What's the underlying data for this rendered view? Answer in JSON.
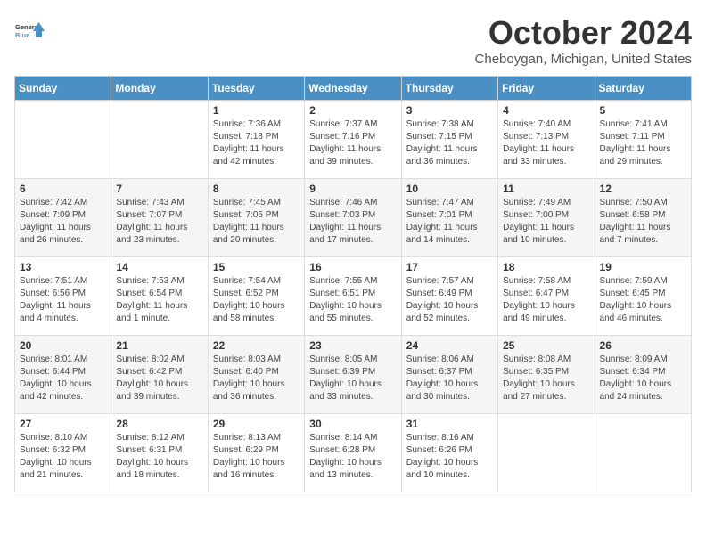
{
  "header": {
    "logo_line1": "General",
    "logo_line2": "Blue",
    "month_title": "October 2024",
    "location": "Cheboygan, Michigan, United States"
  },
  "days_of_week": [
    "Sunday",
    "Monday",
    "Tuesday",
    "Wednesday",
    "Thursday",
    "Friday",
    "Saturday"
  ],
  "weeks": [
    [
      {
        "day": "",
        "content": ""
      },
      {
        "day": "",
        "content": ""
      },
      {
        "day": "1",
        "content": "Sunrise: 7:36 AM\nSunset: 7:18 PM\nDaylight: 11 hours and 42 minutes."
      },
      {
        "day": "2",
        "content": "Sunrise: 7:37 AM\nSunset: 7:16 PM\nDaylight: 11 hours and 39 minutes."
      },
      {
        "day": "3",
        "content": "Sunrise: 7:38 AM\nSunset: 7:15 PM\nDaylight: 11 hours and 36 minutes."
      },
      {
        "day": "4",
        "content": "Sunrise: 7:40 AM\nSunset: 7:13 PM\nDaylight: 11 hours and 33 minutes."
      },
      {
        "day": "5",
        "content": "Sunrise: 7:41 AM\nSunset: 7:11 PM\nDaylight: 11 hours and 29 minutes."
      }
    ],
    [
      {
        "day": "6",
        "content": "Sunrise: 7:42 AM\nSunset: 7:09 PM\nDaylight: 11 hours and 26 minutes."
      },
      {
        "day": "7",
        "content": "Sunrise: 7:43 AM\nSunset: 7:07 PM\nDaylight: 11 hours and 23 minutes."
      },
      {
        "day": "8",
        "content": "Sunrise: 7:45 AM\nSunset: 7:05 PM\nDaylight: 11 hours and 20 minutes."
      },
      {
        "day": "9",
        "content": "Sunrise: 7:46 AM\nSunset: 7:03 PM\nDaylight: 11 hours and 17 minutes."
      },
      {
        "day": "10",
        "content": "Sunrise: 7:47 AM\nSunset: 7:01 PM\nDaylight: 11 hours and 14 minutes."
      },
      {
        "day": "11",
        "content": "Sunrise: 7:49 AM\nSunset: 7:00 PM\nDaylight: 11 hours and 10 minutes."
      },
      {
        "day": "12",
        "content": "Sunrise: 7:50 AM\nSunset: 6:58 PM\nDaylight: 11 hours and 7 minutes."
      }
    ],
    [
      {
        "day": "13",
        "content": "Sunrise: 7:51 AM\nSunset: 6:56 PM\nDaylight: 11 hours and 4 minutes."
      },
      {
        "day": "14",
        "content": "Sunrise: 7:53 AM\nSunset: 6:54 PM\nDaylight: 11 hours and 1 minute."
      },
      {
        "day": "15",
        "content": "Sunrise: 7:54 AM\nSunset: 6:52 PM\nDaylight: 10 hours and 58 minutes."
      },
      {
        "day": "16",
        "content": "Sunrise: 7:55 AM\nSunset: 6:51 PM\nDaylight: 10 hours and 55 minutes."
      },
      {
        "day": "17",
        "content": "Sunrise: 7:57 AM\nSunset: 6:49 PM\nDaylight: 10 hours and 52 minutes."
      },
      {
        "day": "18",
        "content": "Sunrise: 7:58 AM\nSunset: 6:47 PM\nDaylight: 10 hours and 49 minutes."
      },
      {
        "day": "19",
        "content": "Sunrise: 7:59 AM\nSunset: 6:45 PM\nDaylight: 10 hours and 46 minutes."
      }
    ],
    [
      {
        "day": "20",
        "content": "Sunrise: 8:01 AM\nSunset: 6:44 PM\nDaylight: 10 hours and 42 minutes."
      },
      {
        "day": "21",
        "content": "Sunrise: 8:02 AM\nSunset: 6:42 PM\nDaylight: 10 hours and 39 minutes."
      },
      {
        "day": "22",
        "content": "Sunrise: 8:03 AM\nSunset: 6:40 PM\nDaylight: 10 hours and 36 minutes."
      },
      {
        "day": "23",
        "content": "Sunrise: 8:05 AM\nSunset: 6:39 PM\nDaylight: 10 hours and 33 minutes."
      },
      {
        "day": "24",
        "content": "Sunrise: 8:06 AM\nSunset: 6:37 PM\nDaylight: 10 hours and 30 minutes."
      },
      {
        "day": "25",
        "content": "Sunrise: 8:08 AM\nSunset: 6:35 PM\nDaylight: 10 hours and 27 minutes."
      },
      {
        "day": "26",
        "content": "Sunrise: 8:09 AM\nSunset: 6:34 PM\nDaylight: 10 hours and 24 minutes."
      }
    ],
    [
      {
        "day": "27",
        "content": "Sunrise: 8:10 AM\nSunset: 6:32 PM\nDaylight: 10 hours and 21 minutes."
      },
      {
        "day": "28",
        "content": "Sunrise: 8:12 AM\nSunset: 6:31 PM\nDaylight: 10 hours and 18 minutes."
      },
      {
        "day": "29",
        "content": "Sunrise: 8:13 AM\nSunset: 6:29 PM\nDaylight: 10 hours and 16 minutes."
      },
      {
        "day": "30",
        "content": "Sunrise: 8:14 AM\nSunset: 6:28 PM\nDaylight: 10 hours and 13 minutes."
      },
      {
        "day": "31",
        "content": "Sunrise: 8:16 AM\nSunset: 6:26 PM\nDaylight: 10 hours and 10 minutes."
      },
      {
        "day": "",
        "content": ""
      },
      {
        "day": "",
        "content": ""
      }
    ]
  ]
}
